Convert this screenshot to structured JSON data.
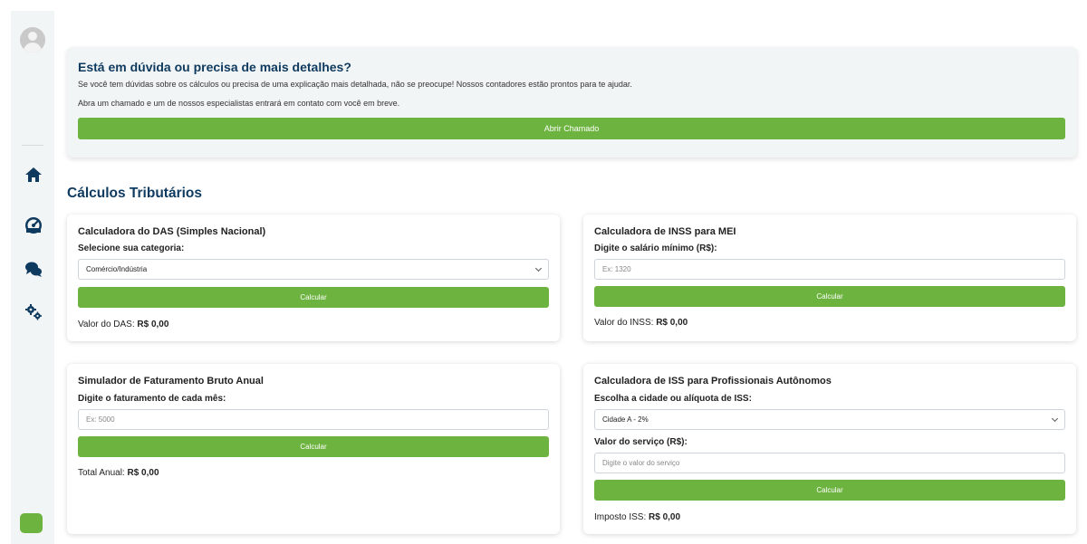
{
  "help": {
    "title": "Está em dúvida ou precisa de mais detalhes?",
    "text1": "Se você tem dúvidas sobre os cálculos ou precisa de uma explicação mais detalhada, não se preocupe! Nossos contadores estão prontos para te ajudar.",
    "text2": "Abra um chamado e um de nossos especialistas entrará em contato com você em breve.",
    "button": "Abrir Chamado"
  },
  "section_title": "Cálculos Tributários",
  "das": {
    "title": "Calculadora do DAS (Simples Nacional)",
    "label": "Selecione sua categoria:",
    "selected": "Comércio/Indústria",
    "button": "Calcular",
    "result_label": "Valor do DAS:",
    "result_value": "R$ 0,00"
  },
  "inss": {
    "title": "Calculadora de INSS para MEI",
    "label": "Digite o salário mínimo (R$):",
    "placeholder": "Ex: 1320",
    "button": "Calcular",
    "result_label": "Valor do INSS:",
    "result_value": "R$ 0,00"
  },
  "faturamento": {
    "title": "Simulador de Faturamento Bruto Anual",
    "label": "Digite o faturamento de cada mês:",
    "placeholder": "Ex: 5000",
    "button": "Calcular",
    "result_label": "Total Anual:",
    "result_value": "R$ 0,00"
  },
  "iss": {
    "title": "Calculadora de ISS para Profissionais Autônomos",
    "label_city": "Escolha a cidade ou alíquota de ISS:",
    "selected": "Cidade A - 2%",
    "label_value": "Valor do serviço (R$):",
    "placeholder": "Digite o valor do serviço",
    "button": "Calcular",
    "result_label": "Imposto ISS:",
    "result_value": "R$ 0,00"
  },
  "sidebar_icons": [
    "user-avatar-icon",
    "home-icon",
    "dashboard-icon",
    "chat-icon",
    "settings-icon"
  ],
  "colors": {
    "accent": "#6db33f",
    "title": "#0f3a5f",
    "panel": "#f1f5f5"
  }
}
